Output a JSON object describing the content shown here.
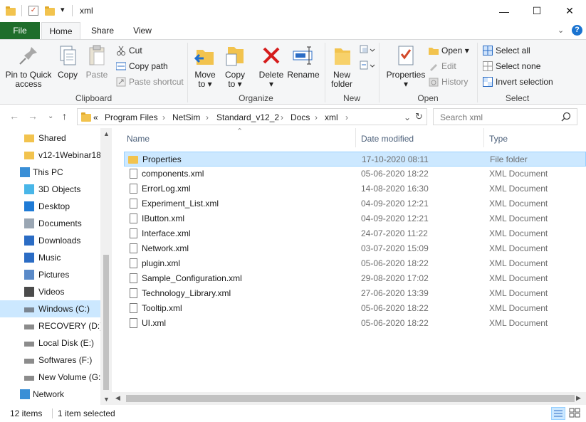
{
  "window": {
    "title": "xml",
    "minimize": "—",
    "maximize": "☐",
    "close": "✕"
  },
  "tabs": {
    "file": "File",
    "home": "Home",
    "share": "Share",
    "view": "View"
  },
  "ribbon": {
    "clipboard": {
      "label": "Clipboard",
      "pin_line1": "Pin to Quick",
      "pin_line2": "access",
      "copy": "Copy",
      "paste": "Paste",
      "cut": "Cut",
      "copy_path": "Copy path",
      "paste_shortcut": "Paste shortcut"
    },
    "organize": {
      "label": "Organize",
      "move_line1": "Move",
      "move_line2": "to ▾",
      "copy_line1": "Copy",
      "copy_line2": "to ▾",
      "delete_line1": "Delete",
      "delete_line2": "▾",
      "rename": "Rename"
    },
    "new": {
      "label": "New",
      "new_folder_line1": "New",
      "new_folder_line2": "folder"
    },
    "open": {
      "label": "Open",
      "properties_line1": "Properties",
      "properties_line2": "▾",
      "open": "Open ▾",
      "edit": "Edit",
      "history": "History"
    },
    "select": {
      "label": "Select",
      "select_all": "Select all",
      "select_none": "Select none",
      "invert": "Invert selection"
    }
  },
  "address": {
    "overflow": "«",
    "crumbs": [
      "Program Files",
      "NetSim",
      "Standard_v12_2",
      "Docs",
      "xml"
    ],
    "separator": "›",
    "search_placeholder": "Search xml"
  },
  "nav_pane": {
    "items": [
      {
        "label": "Shared",
        "icon": "folder-icon"
      },
      {
        "label": "v12-1Webinar18",
        "icon": "folder-icon"
      },
      {
        "label": "This PC",
        "icon": "computer-icon"
      },
      {
        "label": "3D Objects",
        "icon": "cube-icon"
      },
      {
        "label": "Desktop",
        "icon": "desktop-icon"
      },
      {
        "label": "Documents",
        "icon": "documents-icon"
      },
      {
        "label": "Downloads",
        "icon": "download-icon"
      },
      {
        "label": "Music",
        "icon": "music-icon"
      },
      {
        "label": "Pictures",
        "icon": "pictures-icon"
      },
      {
        "label": "Videos",
        "icon": "videos-icon"
      },
      {
        "label": "Windows (C:)",
        "icon": "windows-drive-icon"
      },
      {
        "label": "RECOVERY (D:)",
        "icon": "drive-icon"
      },
      {
        "label": "Local Disk (E:)",
        "icon": "drive-icon"
      },
      {
        "label": "Softwares (F:)",
        "icon": "drive-icon"
      },
      {
        "label": "New Volume (G:",
        "icon": "drive-icon"
      },
      {
        "label": "Network",
        "icon": "network-icon"
      }
    ]
  },
  "file_list": {
    "columns": {
      "name": "Name",
      "date": "Date modified",
      "type": "Type"
    },
    "rows": [
      {
        "name": "Properties",
        "date": "17-10-2020 08:11",
        "type": "File folder"
      },
      {
        "name": "components.xml",
        "date": "05-06-2020 18:22",
        "type": "XML Document"
      },
      {
        "name": "ErrorLog.xml",
        "date": "14-08-2020 16:30",
        "type": "XML Document"
      },
      {
        "name": "Experiment_List.xml",
        "date": "04-09-2020 12:21",
        "type": "XML Document"
      },
      {
        "name": "IButton.xml",
        "date": "04-09-2020 12:21",
        "type": "XML Document"
      },
      {
        "name": "Interface.xml",
        "date": "24-07-2020 11:22",
        "type": "XML Document"
      },
      {
        "name": "Network.xml",
        "date": "03-07-2020 15:09",
        "type": "XML Document"
      },
      {
        "name": "plugin.xml",
        "date": "05-06-2020 18:22",
        "type": "XML Document"
      },
      {
        "name": "Sample_Configuration.xml",
        "date": "29-08-2020 17:02",
        "type": "XML Document"
      },
      {
        "name": "Technology_Library.xml",
        "date": "27-06-2020 13:39",
        "type": "XML Document"
      },
      {
        "name": "Tooltip.xml",
        "date": "05-06-2020 18:22",
        "type": "XML Document"
      },
      {
        "name": "UI.xml",
        "date": "05-06-2020 18:22",
        "type": "XML Document"
      }
    ]
  },
  "status": {
    "items": "12 items",
    "selected": "1 item selected"
  }
}
